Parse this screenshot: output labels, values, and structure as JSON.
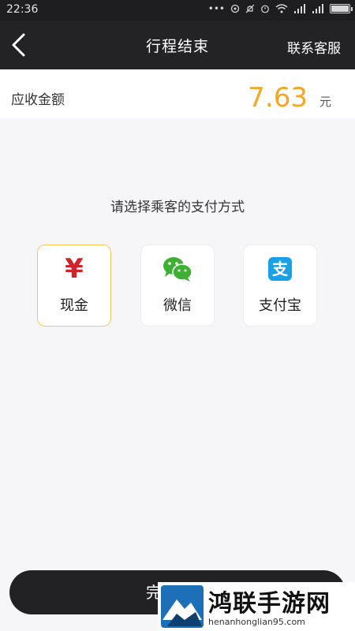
{
  "status_bar": {
    "time": "22:36",
    "dots": "•••"
  },
  "header": {
    "title": "行程结束",
    "contact_label": "联系客服"
  },
  "amount": {
    "label": "应收金额",
    "value": "7.63",
    "unit": "元",
    "value_color": "#f5a623"
  },
  "prompt": "请选择乘客的支付方式",
  "payment_methods": [
    {
      "label": "现金",
      "icon": "yuan-icon",
      "icon_glyph": "¥",
      "selected": true
    },
    {
      "label": "微信",
      "icon": "wechat-icon",
      "selected": false
    },
    {
      "label": "支付宝",
      "icon": "alipay-icon",
      "icon_glyph": "支",
      "selected": false
    }
  ],
  "finish_button": {
    "label": "完"
  },
  "watermark": {
    "text": "鸿联手游网",
    "url": "henanhonglian95.com"
  }
}
